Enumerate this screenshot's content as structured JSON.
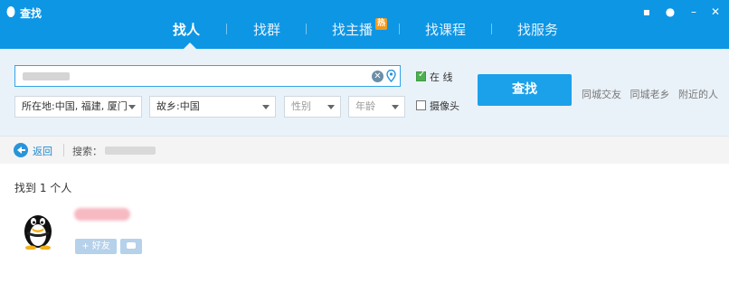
{
  "window": {
    "title": "查找",
    "controls": [
      "message-icon",
      "lock-icon",
      "minimize-icon",
      "close-icon"
    ]
  },
  "tabs": [
    {
      "label": "找人",
      "active": true
    },
    {
      "label": "找群",
      "active": false
    },
    {
      "label": "找主播",
      "active": false,
      "badge": "热"
    },
    {
      "label": "找课程",
      "active": false
    },
    {
      "label": "找服务",
      "active": false
    }
  ],
  "search": {
    "keyword": "",
    "filters": {
      "location": "所在地:中国, 福建, 厦门",
      "hometown": "故乡:中国",
      "gender": "性别",
      "age": "年龄"
    },
    "online": {
      "label": "在  线",
      "checked": true
    },
    "camera": {
      "label": "摄像头",
      "checked": false
    },
    "button_label": "查找",
    "quick_links": [
      "同城交友",
      "同城老乡",
      "附近的人"
    ]
  },
  "nav": {
    "back_label": "返回",
    "search_prefix": "搜索："
  },
  "results": {
    "count_text": "找到 1 个人",
    "items": [
      {
        "add_friend_label": "+ 好友"
      }
    ]
  },
  "colors": {
    "titlebar": "#0d96e4",
    "panel": "#eaf2f9",
    "button": "#1ba1ea",
    "hot_badge": "#f39a1c"
  }
}
